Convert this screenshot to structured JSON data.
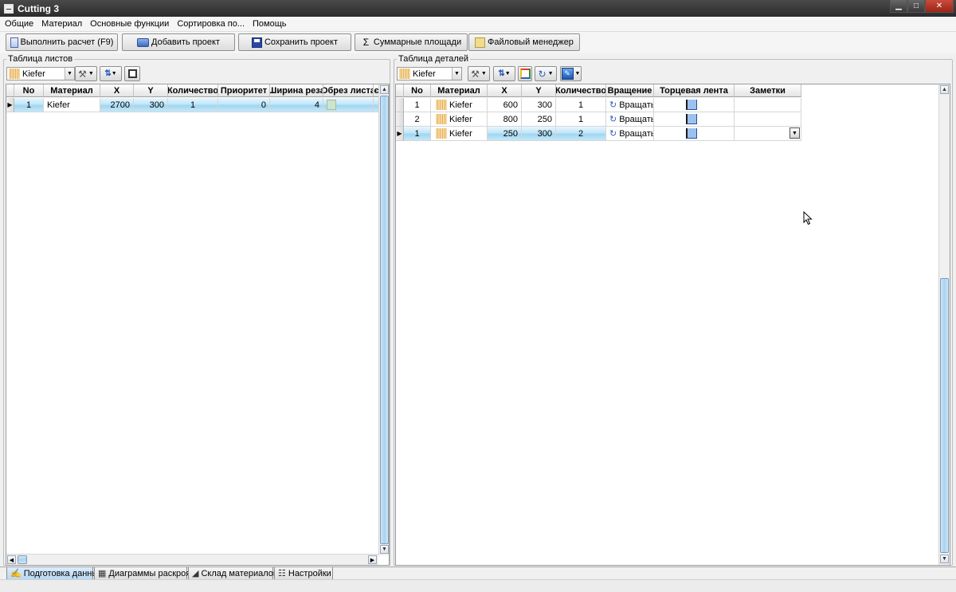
{
  "window": {
    "title": "Cutting 3"
  },
  "menu": [
    "Общие",
    "Материал",
    "Основные функции",
    "Сортировка по...",
    "Помощь"
  ],
  "toolbar": {
    "calc_label": "Выполнить расчет (F9)",
    "add_label": "Добавить проект",
    "save_label": "Сохранить проект",
    "sum_label": "Суммарные площади",
    "fm_label": "Файловый менеджер"
  },
  "sheets_panel": {
    "title": "Таблица листов",
    "material": "Kiefer",
    "columns": [
      "No",
      "Материал",
      "X",
      "Y",
      "Количество",
      "Приоритет",
      "Ширина реза",
      "Обрез листа",
      "є"
    ],
    "rows": [
      {
        "no": "1",
        "material": "Kiefer",
        "x": "2700",
        "y": "300",
        "qty": "1",
        "priority": "0",
        "kerf": "4",
        "trim": ""
      }
    ]
  },
  "parts_panel": {
    "title": "Таблица деталей",
    "material": "Kiefer",
    "columns": [
      "No",
      "Материал",
      "X",
      "Y",
      "Количество",
      "Вращение",
      "Торцевая лента",
      "Заметки"
    ],
    "rows": [
      {
        "no": "1",
        "material": "Kiefer",
        "x": "600",
        "y": "300",
        "qty": "1",
        "rotation": "Вращать",
        "notes": ""
      },
      {
        "no": "2",
        "material": "Kiefer",
        "x": "800",
        "y": "250",
        "qty": "1",
        "rotation": "Вращать",
        "notes": ""
      },
      {
        "no": "1",
        "material": "Kiefer",
        "x": "250",
        "y": "300",
        "qty": "2",
        "rotation": "Вращать",
        "notes": ""
      }
    ]
  },
  "tabs": [
    "Подготовка данных",
    "Диаграммы раскроя",
    "Склад материалов",
    "Настройки"
  ]
}
